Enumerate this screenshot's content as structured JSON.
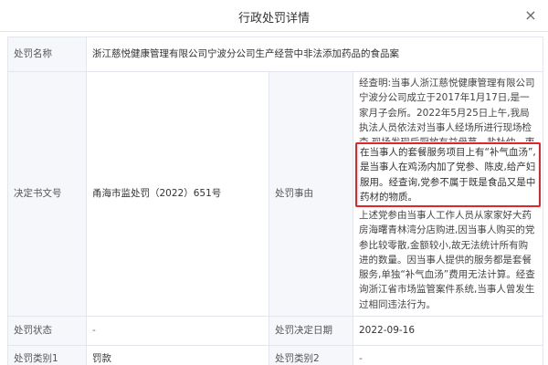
{
  "dialog": {
    "title": "行政处罚详情",
    "close_glyph": "×"
  },
  "rows": {
    "penalty_name": {
      "label": "处罚名称",
      "value": "浙江慈悦健康管理有限公司宁波分公司生产经营中非法添加药品的食品案"
    },
    "decision_no": {
      "label": "决定书文号",
      "value": "甬海市监处罚（2022）651号"
    },
    "reason": {
      "label": "处罚事由",
      "text_before": "经查明:当事人浙江慈悦健康管理有限公司宁波分公司成立于2017年1月17日,是一家月子会所。2022年5月25日上午,我局执法人员依法对当事人经场所进行现场检查,现场发现后厨放有益母草、盐杜仲、枣冬、党参等中药各一罐。",
      "text_highlight": "在当事人的套餐服务项目上有“补气血汤”,是当事人在鸡汤内加了党参、陈皮,给产妇服用。经查询,党参不属于既是食品又是中药材的物质。",
      "text_after": "上述党参由当事人工作人员从家家好大药房海曙青林湾分店购进,因当事人购买的党参比较零散,金额较小,故无法统计所有购进的数量。因当事人提供的服务都是套餐服务,单独“补气血汤”费用无法计算。经查询浙江省市场监管案件系统,当事人曾发生过相同违法行为。"
    },
    "status": {
      "label": "处罚状态",
      "value": "-"
    },
    "decision_date": {
      "label": "处罚决定日期",
      "value": "2022-09-16"
    },
    "category1": {
      "label": "处罚类别1",
      "value": "罚款"
    },
    "category2": {
      "label": "处罚类别2",
      "value": "-"
    }
  },
  "colors": {
    "label_bg": "#f5f7fa",
    "border": "#e3e6ec",
    "highlight_border": "#e0252b"
  }
}
